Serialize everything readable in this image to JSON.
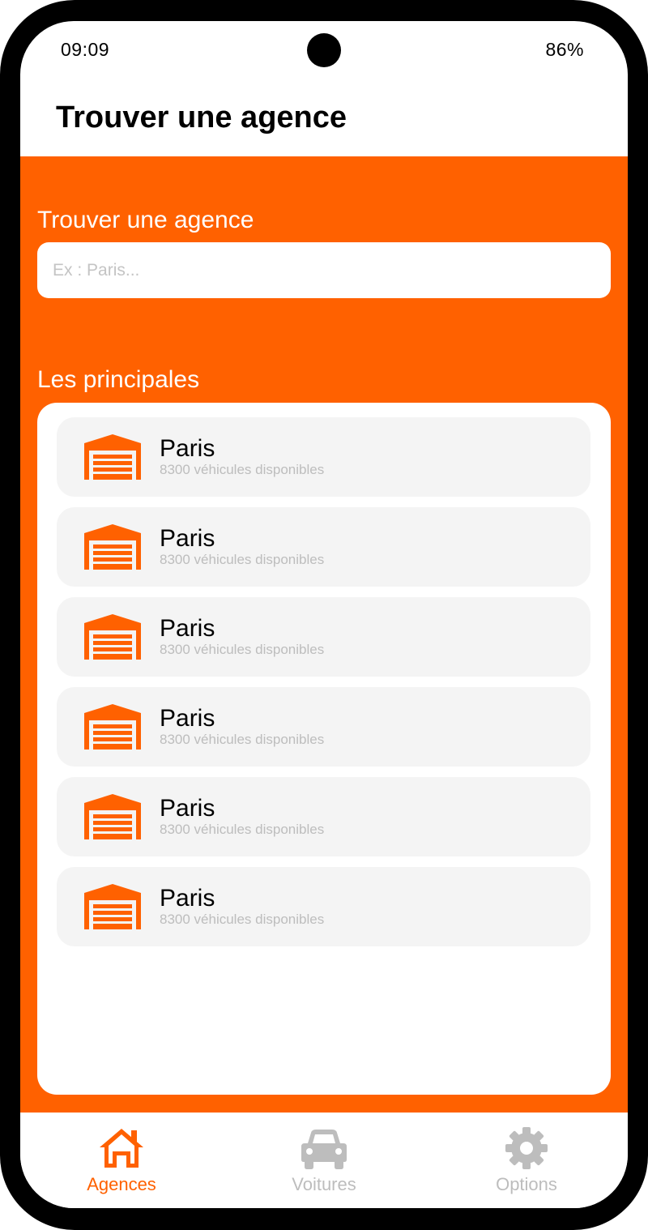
{
  "status_bar": {
    "time": "09:09",
    "battery": "86%"
  },
  "header": {
    "title": "Trouver une agence"
  },
  "search": {
    "label": "Trouver une agence",
    "placeholder": "Ex : Paris...",
    "value": ""
  },
  "list": {
    "label": "Les principales",
    "items": [
      {
        "name": "Paris",
        "subtitle": "8300 véhicules disponibles",
        "icon": "garage-icon"
      },
      {
        "name": "Paris",
        "subtitle": "8300 véhicules disponibles",
        "icon": "garage-icon"
      },
      {
        "name": "Paris",
        "subtitle": "8300 véhicules disponibles",
        "icon": "garage-icon"
      },
      {
        "name": "Paris",
        "subtitle": "8300 véhicules disponibles",
        "icon": "garage-icon"
      },
      {
        "name": "Paris",
        "subtitle": "8300 véhicules disponibles",
        "icon": "garage-icon"
      },
      {
        "name": "Paris",
        "subtitle": "8300 véhicules disponibles",
        "icon": "garage-icon"
      }
    ]
  },
  "nav": {
    "items": [
      {
        "label": "Agences",
        "icon": "home-icon",
        "active": true
      },
      {
        "label": "Voitures",
        "icon": "car-icon",
        "active": false
      },
      {
        "label": "Options",
        "icon": "gear-icon",
        "active": false
      }
    ]
  },
  "colors": {
    "accent": "#FF6100",
    "inactive": "#BDBDBD",
    "card": "#F4F4F4",
    "subtitle": "#BDBDBD"
  }
}
